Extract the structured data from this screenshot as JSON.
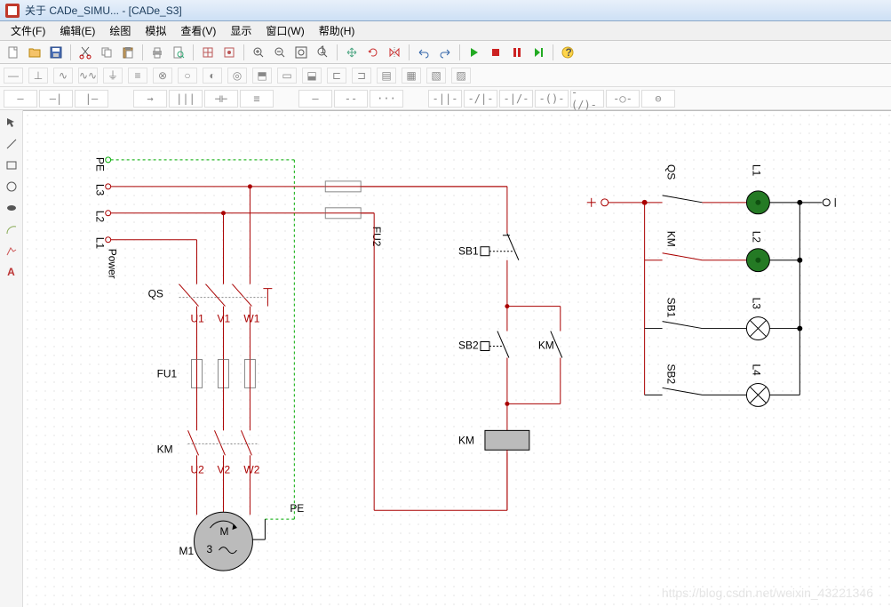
{
  "title": "关于 CADe_SIMU... - [CADe_S3]",
  "menu": {
    "file": "文件(F)",
    "edit": "编辑(E)",
    "draw": "绘图",
    "simu": "模拟",
    "view": "查看(V)",
    "show": "显示",
    "window": "窗口(W)",
    "help": "帮助(H)"
  },
  "labels": {
    "PE": "PE",
    "L1": "L1",
    "L2": "L2",
    "L3": "L3",
    "Power": "Power",
    "QS": "QS",
    "FU1": "FU1",
    "FU2": "FU2",
    "KM": "KM",
    "M1": "M1",
    "PE2": "PE",
    "M": "M",
    "three": "3",
    "U1": "U1",
    "V1": "V1",
    "W1": "W1",
    "U2": "U2",
    "V2": "V2",
    "W2": "W2",
    "SB1": "SB1",
    "SB2": "SB2",
    "rQS": "QS",
    "rKM": "KM",
    "rSB1": "SB1",
    "rSB2": "SB2",
    "rL1": "L1",
    "rL2": "L2",
    "rL3": "L3",
    "rL4": "L4"
  },
  "watermark": "https://blog.csdn.net/weixin_43221346"
}
